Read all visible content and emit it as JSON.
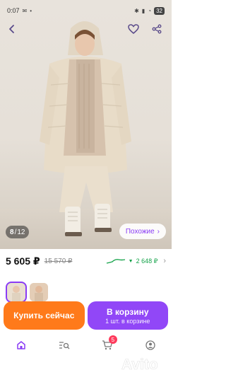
{
  "status_bar": {
    "time": "0:07",
    "battery": "32"
  },
  "gallery": {
    "current": "8",
    "separator": "/",
    "total": "12",
    "similar_label": "Похожие"
  },
  "price": {
    "current": "5 605 ₽",
    "old": "15 570 ₽",
    "drop": "2 648 ₽"
  },
  "actions": {
    "buy_now": "Купить сейчас",
    "add_to_cart": "В корзину",
    "cart_count": "1 шт. в корзине"
  },
  "nav": {
    "cart_badge": "5"
  },
  "colors": {
    "buy_button": "#ff7a1a",
    "cart_button": "#9147f7",
    "accent": "#8a3cf5",
    "price_drop": "#15a34a"
  },
  "icons": [
    "back-arrow-icon",
    "heart-icon",
    "share-icon",
    "chevron-right-icon",
    "home-icon",
    "search-list-icon",
    "cart-icon",
    "profile-icon"
  ]
}
